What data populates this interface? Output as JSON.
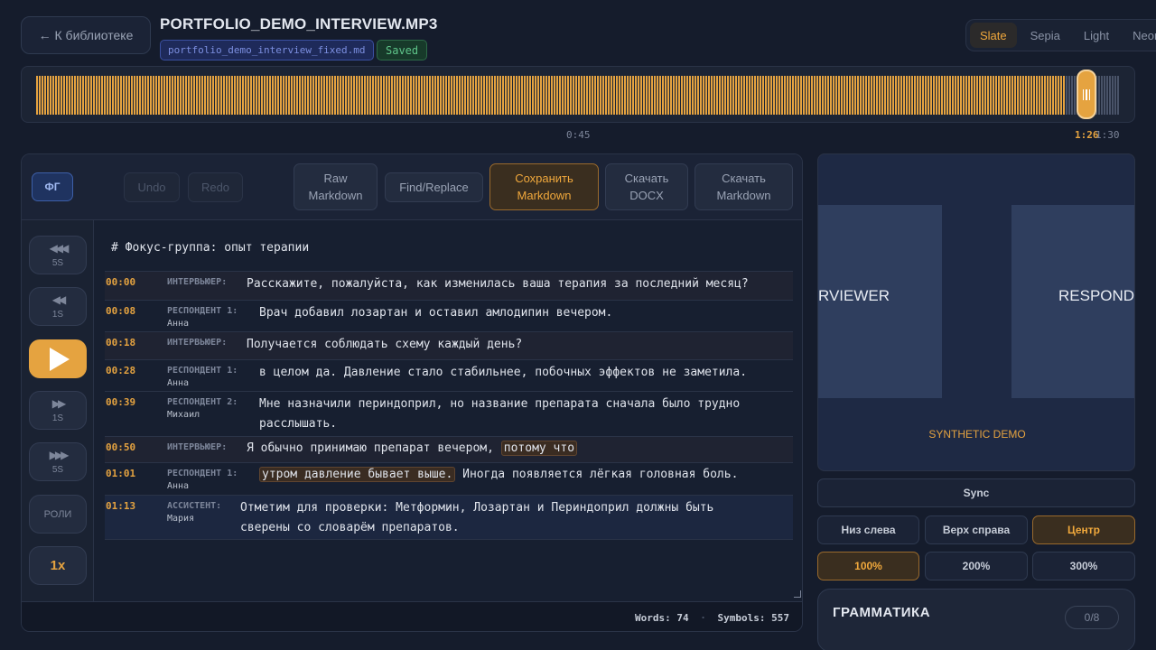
{
  "header": {
    "back_label": "← К библиотеке",
    "file_title": "PORTFOLIO_DEMO_INTERVIEW.MP3",
    "md_file": "portfolio_demo_interview_fixed.md",
    "saved_label": "Saved",
    "themes": [
      "Slate",
      "Sepia",
      "Light",
      "Neon"
    ],
    "active_theme": "Slate"
  },
  "colors": {
    "accent": "#e5a340",
    "background": "#151c2c",
    "panel": "#171f30",
    "saved_green": "#5fc58a",
    "badge_blue": "#7c8fe0"
  },
  "player": {
    "tick_mid": "0:45",
    "current_time": "1:26",
    "total_time": "1:30",
    "progress_fraction": 0.95
  },
  "toolbar": {
    "fg_label": "ФГ",
    "undo_label": "Undo",
    "redo_label": "Redo",
    "raw_markdown_label": "Raw Markdown",
    "find_replace_label": "Find/Replace",
    "save_markdown_label": "Сохранить Markdown",
    "download_docx_label": "Скачать DOCX",
    "download_markdown_label": "Скачать Markdown"
  },
  "sidebar": {
    "back5_label": "5S",
    "back1_label": "1S",
    "fwd1_label": "1S",
    "fwd5_label": "5S",
    "roles_label": "РОЛИ",
    "speed_label": "1x",
    "icons": [
      "rewind-5s-icon",
      "rewind-1s-icon",
      "play-icon",
      "forward-1s-icon",
      "forward-5s-icon"
    ]
  },
  "document": {
    "heading": "# Фокус-группа: опыт терапии",
    "segments": [
      {
        "time": "00:00",
        "speaker": "ИНТЕРВЬЮЕР:",
        "name": "",
        "lines": [
          "Расскажите, пожалуйста, как изменилась ваша терапия за последний месяц?"
        ]
      },
      {
        "time": "00:08",
        "speaker": "РЕСПОНДЕНТ 1:",
        "name": "Анна",
        "lines": [
          "Врач добавил лозартан и оставил амлодипин вечером."
        ]
      },
      {
        "time": "00:18",
        "speaker": "ИНТЕРВЬЮЕР:",
        "name": "",
        "lines": [
          "Получается соблюдать схему каждый день?"
        ]
      },
      {
        "time": "00:28",
        "speaker": "РЕСПОНДЕНТ 1:",
        "name": "Анна",
        "lines": [
          "в целом да. Давление стало стабильнее, побочных эффектов не заметила."
        ]
      },
      {
        "time": "00:39",
        "speaker": "РЕСПОНДЕНТ 2:",
        "name": "Михаил",
        "lines": [
          "Мне назначили периндоприл, но название препарата сначала было трудно",
          "расслышать."
        ]
      },
      {
        "time": "00:50",
        "speaker": "ИНТЕРВЬЮЕР:",
        "name": "",
        "text_before": "Я обычно принимаю препарат вечером, ",
        "highlight": "потому что"
      },
      {
        "time": "01:01",
        "speaker": "РЕСПОНДЕНТ 1:",
        "name": "Анна",
        "highlight": "утром давление бывает выше.",
        "text_after": " Иногда появляется лёгкая головная боль."
      },
      {
        "time": "01:13",
        "speaker": "АССИСТЕНТ:",
        "name": "Мария",
        "lines": [
          "Отметим для проверки: Метформин, Лозартан и Периндоприл должны быть",
          "сверены со словарём препаратов."
        ]
      }
    ],
    "stats": {
      "words_label": "Words:",
      "words": "74",
      "symbols_label": "Symbols:",
      "symbols": "557"
    }
  },
  "preview": {
    "left_label": "RVIEWER",
    "right_label": "RESPOND",
    "demo_label": "SYNTHETIC DEMO",
    "sync_label": "Sync",
    "positions": [
      "Низ слева",
      "Верх справа",
      "Центр"
    ],
    "active_position": "Центр",
    "zooms": [
      "100%",
      "200%",
      "300%"
    ],
    "active_zoom": "100%"
  },
  "grammar": {
    "title": "ГРАММАТИКА",
    "count": "0/8"
  }
}
